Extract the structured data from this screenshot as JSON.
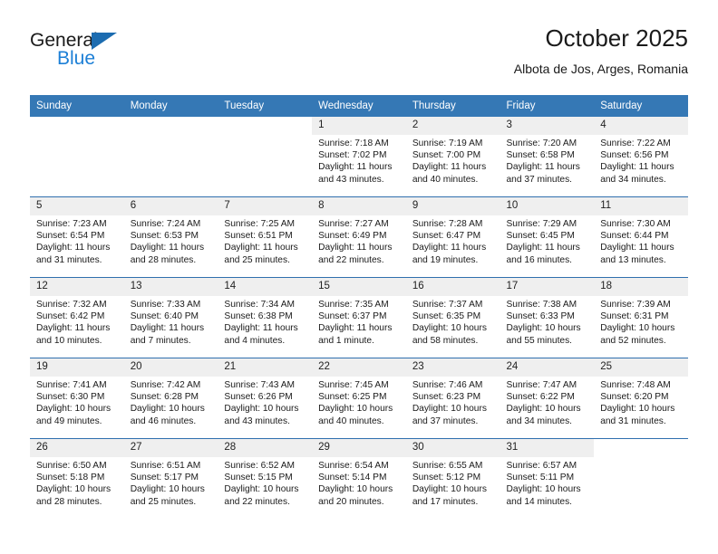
{
  "brand": {
    "name_top": "General",
    "name_bottom": "Blue",
    "triangle_color": "#1c6cb0",
    "blue_color": "#1c7fd6"
  },
  "header": {
    "title": "October 2025",
    "subtitle": "Albota de Jos, Arges, Romania"
  },
  "theme": {
    "header_blue": "#3578b5",
    "row_divider_blue": "#2f6fae",
    "daynum_band": "#efefef"
  },
  "weekdays": [
    "Sunday",
    "Monday",
    "Tuesday",
    "Wednesday",
    "Thursday",
    "Friday",
    "Saturday"
  ],
  "labels": {
    "sunrise_prefix": "Sunrise:",
    "sunset_prefix": "Sunset:",
    "daylight_prefix": "Daylight:"
  },
  "weeks": [
    [
      {
        "day": "",
        "sunrise": "",
        "sunset": "",
        "daylight_line1": "",
        "daylight_line2": ""
      },
      {
        "day": "",
        "sunrise": "",
        "sunset": "",
        "daylight_line1": "",
        "daylight_line2": ""
      },
      {
        "day": "",
        "sunrise": "",
        "sunset": "",
        "daylight_line1": "",
        "daylight_line2": ""
      },
      {
        "day": "1",
        "sunrise": "Sunrise: 7:18 AM",
        "sunset": "Sunset: 7:02 PM",
        "daylight_line1": "Daylight: 11 hours",
        "daylight_line2": "and 43 minutes."
      },
      {
        "day": "2",
        "sunrise": "Sunrise: 7:19 AM",
        "sunset": "Sunset: 7:00 PM",
        "daylight_line1": "Daylight: 11 hours",
        "daylight_line2": "and 40 minutes."
      },
      {
        "day": "3",
        "sunrise": "Sunrise: 7:20 AM",
        "sunset": "Sunset: 6:58 PM",
        "daylight_line1": "Daylight: 11 hours",
        "daylight_line2": "and 37 minutes."
      },
      {
        "day": "4",
        "sunrise": "Sunrise: 7:22 AM",
        "sunset": "Sunset: 6:56 PM",
        "daylight_line1": "Daylight: 11 hours",
        "daylight_line2": "and 34 minutes."
      }
    ],
    [
      {
        "day": "5",
        "sunrise": "Sunrise: 7:23 AM",
        "sunset": "Sunset: 6:54 PM",
        "daylight_line1": "Daylight: 11 hours",
        "daylight_line2": "and 31 minutes."
      },
      {
        "day": "6",
        "sunrise": "Sunrise: 7:24 AM",
        "sunset": "Sunset: 6:53 PM",
        "daylight_line1": "Daylight: 11 hours",
        "daylight_line2": "and 28 minutes."
      },
      {
        "day": "7",
        "sunrise": "Sunrise: 7:25 AM",
        "sunset": "Sunset: 6:51 PM",
        "daylight_line1": "Daylight: 11 hours",
        "daylight_line2": "and 25 minutes."
      },
      {
        "day": "8",
        "sunrise": "Sunrise: 7:27 AM",
        "sunset": "Sunset: 6:49 PM",
        "daylight_line1": "Daylight: 11 hours",
        "daylight_line2": "and 22 minutes."
      },
      {
        "day": "9",
        "sunrise": "Sunrise: 7:28 AM",
        "sunset": "Sunset: 6:47 PM",
        "daylight_line1": "Daylight: 11 hours",
        "daylight_line2": "and 19 minutes."
      },
      {
        "day": "10",
        "sunrise": "Sunrise: 7:29 AM",
        "sunset": "Sunset: 6:45 PM",
        "daylight_line1": "Daylight: 11 hours",
        "daylight_line2": "and 16 minutes."
      },
      {
        "day": "11",
        "sunrise": "Sunrise: 7:30 AM",
        "sunset": "Sunset: 6:44 PM",
        "daylight_line1": "Daylight: 11 hours",
        "daylight_line2": "and 13 minutes."
      }
    ],
    [
      {
        "day": "12",
        "sunrise": "Sunrise: 7:32 AM",
        "sunset": "Sunset: 6:42 PM",
        "daylight_line1": "Daylight: 11 hours",
        "daylight_line2": "and 10 minutes."
      },
      {
        "day": "13",
        "sunrise": "Sunrise: 7:33 AM",
        "sunset": "Sunset: 6:40 PM",
        "daylight_line1": "Daylight: 11 hours",
        "daylight_line2": "and 7 minutes."
      },
      {
        "day": "14",
        "sunrise": "Sunrise: 7:34 AM",
        "sunset": "Sunset: 6:38 PM",
        "daylight_line1": "Daylight: 11 hours",
        "daylight_line2": "and 4 minutes."
      },
      {
        "day": "15",
        "sunrise": "Sunrise: 7:35 AM",
        "sunset": "Sunset: 6:37 PM",
        "daylight_line1": "Daylight: 11 hours",
        "daylight_line2": "and 1 minute."
      },
      {
        "day": "16",
        "sunrise": "Sunrise: 7:37 AM",
        "sunset": "Sunset: 6:35 PM",
        "daylight_line1": "Daylight: 10 hours",
        "daylight_line2": "and 58 minutes."
      },
      {
        "day": "17",
        "sunrise": "Sunrise: 7:38 AM",
        "sunset": "Sunset: 6:33 PM",
        "daylight_line1": "Daylight: 10 hours",
        "daylight_line2": "and 55 minutes."
      },
      {
        "day": "18",
        "sunrise": "Sunrise: 7:39 AM",
        "sunset": "Sunset: 6:31 PM",
        "daylight_line1": "Daylight: 10 hours",
        "daylight_line2": "and 52 minutes."
      }
    ],
    [
      {
        "day": "19",
        "sunrise": "Sunrise: 7:41 AM",
        "sunset": "Sunset: 6:30 PM",
        "daylight_line1": "Daylight: 10 hours",
        "daylight_line2": "and 49 minutes."
      },
      {
        "day": "20",
        "sunrise": "Sunrise: 7:42 AM",
        "sunset": "Sunset: 6:28 PM",
        "daylight_line1": "Daylight: 10 hours",
        "daylight_line2": "and 46 minutes."
      },
      {
        "day": "21",
        "sunrise": "Sunrise: 7:43 AM",
        "sunset": "Sunset: 6:26 PM",
        "daylight_line1": "Daylight: 10 hours",
        "daylight_line2": "and 43 minutes."
      },
      {
        "day": "22",
        "sunrise": "Sunrise: 7:45 AM",
        "sunset": "Sunset: 6:25 PM",
        "daylight_line1": "Daylight: 10 hours",
        "daylight_line2": "and 40 minutes."
      },
      {
        "day": "23",
        "sunrise": "Sunrise: 7:46 AM",
        "sunset": "Sunset: 6:23 PM",
        "daylight_line1": "Daylight: 10 hours",
        "daylight_line2": "and 37 minutes."
      },
      {
        "day": "24",
        "sunrise": "Sunrise: 7:47 AM",
        "sunset": "Sunset: 6:22 PM",
        "daylight_line1": "Daylight: 10 hours",
        "daylight_line2": "and 34 minutes."
      },
      {
        "day": "25",
        "sunrise": "Sunrise: 7:48 AM",
        "sunset": "Sunset: 6:20 PM",
        "daylight_line1": "Daylight: 10 hours",
        "daylight_line2": "and 31 minutes."
      }
    ],
    [
      {
        "day": "26",
        "sunrise": "Sunrise: 6:50 AM",
        "sunset": "Sunset: 5:18 PM",
        "daylight_line1": "Daylight: 10 hours",
        "daylight_line2": "and 28 minutes."
      },
      {
        "day": "27",
        "sunrise": "Sunrise: 6:51 AM",
        "sunset": "Sunset: 5:17 PM",
        "daylight_line1": "Daylight: 10 hours",
        "daylight_line2": "and 25 minutes."
      },
      {
        "day": "28",
        "sunrise": "Sunrise: 6:52 AM",
        "sunset": "Sunset: 5:15 PM",
        "daylight_line1": "Daylight: 10 hours",
        "daylight_line2": "and 22 minutes."
      },
      {
        "day": "29",
        "sunrise": "Sunrise: 6:54 AM",
        "sunset": "Sunset: 5:14 PM",
        "daylight_line1": "Daylight: 10 hours",
        "daylight_line2": "and 20 minutes."
      },
      {
        "day": "30",
        "sunrise": "Sunrise: 6:55 AM",
        "sunset": "Sunset: 5:12 PM",
        "daylight_line1": "Daylight: 10 hours",
        "daylight_line2": "and 17 minutes."
      },
      {
        "day": "31",
        "sunrise": "Sunrise: 6:57 AM",
        "sunset": "Sunset: 5:11 PM",
        "daylight_line1": "Daylight: 10 hours",
        "daylight_line2": "and 14 minutes."
      },
      {
        "day": "",
        "sunrise": "",
        "sunset": "",
        "daylight_line1": "",
        "daylight_line2": ""
      }
    ]
  ]
}
